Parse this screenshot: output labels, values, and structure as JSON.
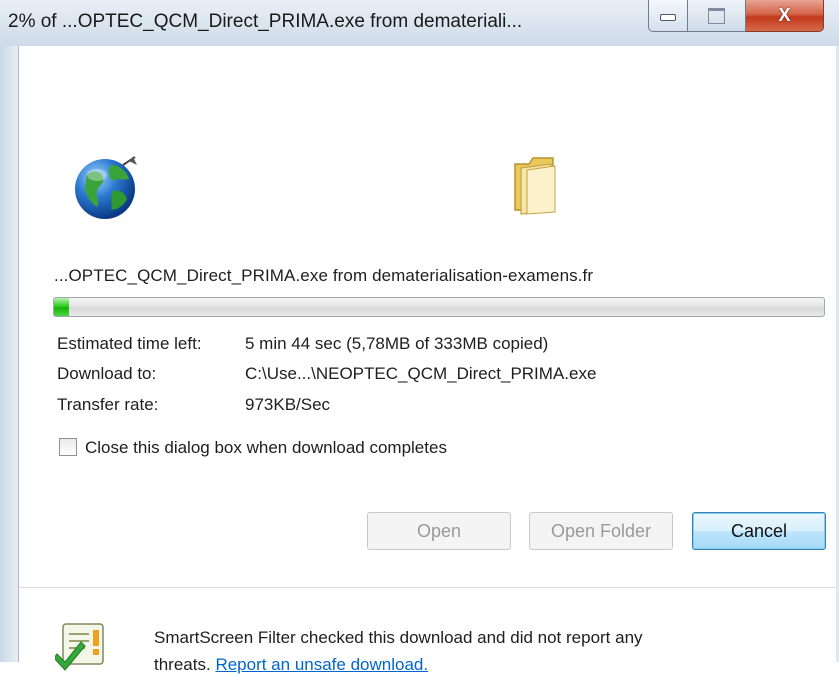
{
  "window": {
    "title": "2% of ...OPTEC_QCM_Direct_PRIMA.exe from demateriali...",
    "controls": {
      "close_glyph": "X"
    }
  },
  "download": {
    "file_line": "...OPTEC_QCM_Direct_PRIMA.exe from dematerialisation-examens.fr",
    "progress_fraction": 0.02,
    "estimated_label": "Estimated time left:",
    "estimated_value": "5 min 44 sec (5,78MB of 333MB copied)",
    "download_to_label": "Download to:",
    "download_to_value": "C:\\Use...\\NEOPTEC_QCM_Direct_PRIMA.exe",
    "rate_label": "Transfer rate:",
    "rate_value": "973KB/Sec",
    "close_checkbox_label": "Close this dialog box when download completes",
    "close_checkbox_checked": false
  },
  "buttons": {
    "open": "Open",
    "open_folder": "Open Folder",
    "cancel": "Cancel"
  },
  "smartscreen": {
    "line1": "SmartScreen Filter checked this download and did not report any",
    "line2_prefix": "threats.",
    "link": "Report an unsafe download."
  },
  "icons": {
    "globe": "globe-icon",
    "folder": "folder-icon",
    "shield": "smartscreen-check-icon"
  },
  "colors": {
    "progress": "#17b40c",
    "link": "#0066cc",
    "close_button": "#c2381d"
  }
}
